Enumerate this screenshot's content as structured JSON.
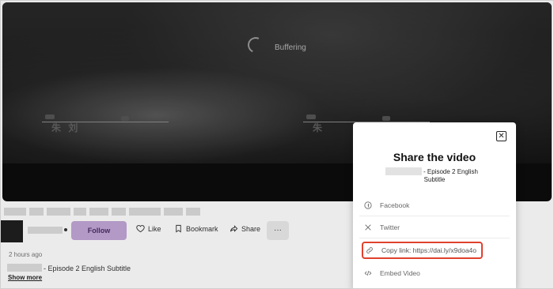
{
  "player": {
    "buffering_label": "Buffering",
    "subtitle_left": "朱 刘",
    "subtitle_right": "朱"
  },
  "video_info": {
    "follow_label": "Follow",
    "actions": {
      "like": "Like",
      "bookmark": "Bookmark",
      "share": "Share",
      "more": "···"
    },
    "timestamp": "2 hours ago",
    "description": "- Episode 2 English Subtitle",
    "show_more": "Show more"
  },
  "share_modal": {
    "title": "Share the video",
    "subtitle_a": "- Episode 2 English",
    "subtitle_b": "Subtitle",
    "close_glyph": "✕",
    "options": {
      "facebook": "Facebook",
      "twitter": "Twitter",
      "copy_link": "Copy link: https://dai.ly/x9doa4o",
      "embed": "Embed Video"
    },
    "icons": {
      "facebook": "facebook-icon",
      "twitter": "x-twitter-icon",
      "copy_link": "link-icon",
      "embed": "code-icon"
    },
    "highlight_color": "#e0412f"
  },
  "colors": {
    "follow_bg": "#c3a6d7",
    "video_bg": "#0c0c0c"
  }
}
